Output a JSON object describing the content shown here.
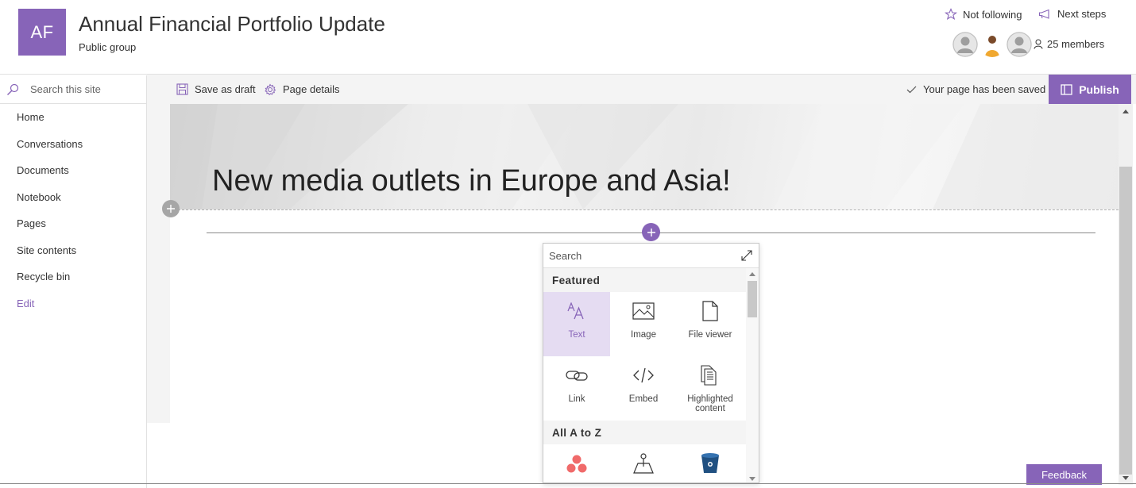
{
  "header": {
    "logo_initials": "AF",
    "site_title": "Annual Financial Portfolio Update",
    "site_subtitle": "Public group",
    "follow_label": "Not following",
    "next_steps_label": "Next steps",
    "members_label": "25 members"
  },
  "sidebar": {
    "search_placeholder": "Search this site",
    "items": [
      {
        "label": "Home"
      },
      {
        "label": "Conversations"
      },
      {
        "label": "Documents"
      },
      {
        "label": "Notebook"
      },
      {
        "label": "Pages"
      },
      {
        "label": "Site contents"
      },
      {
        "label": "Recycle bin"
      },
      {
        "label": "Edit"
      }
    ]
  },
  "command_bar": {
    "save_draft_label": "Save as draft",
    "page_details_label": "Page details",
    "saved_status": "Your page has been saved",
    "publish_label": "Publish"
  },
  "page": {
    "hero_title": "New media outlets in Europe and Asia!"
  },
  "toolbox": {
    "search_placeholder": "Search",
    "featured_heading": "Featured",
    "featured_items": [
      {
        "label": "Text",
        "icon": "text-icon",
        "selected": true
      },
      {
        "label": "Image",
        "icon": "image-icon"
      },
      {
        "label": "File viewer",
        "icon": "file-icon"
      },
      {
        "label": "Link",
        "icon": "link-icon"
      },
      {
        "label": "Embed",
        "icon": "embed-icon"
      },
      {
        "label": "Highlighted\ncontent",
        "icon": "highlighted-content-icon"
      }
    ],
    "all_heading": "All A to Z"
  },
  "feedback_label": "Feedback",
  "colors": {
    "accent": "#8764b8",
    "selected_bg": "#e5dcf2"
  }
}
